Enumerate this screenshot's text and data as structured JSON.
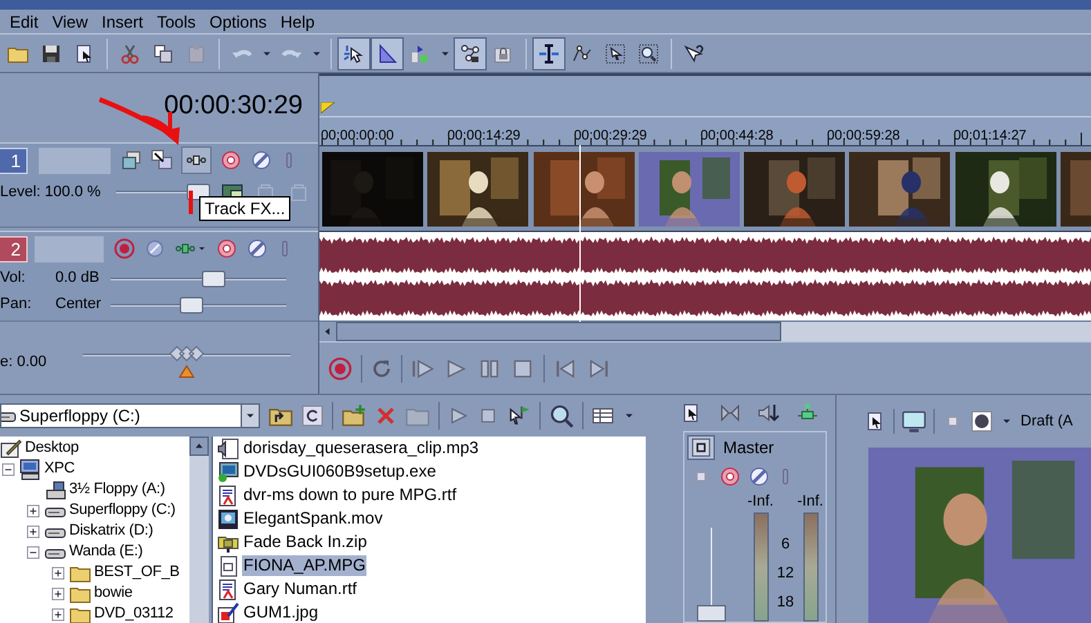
{
  "menu": [
    "Edit",
    "View",
    "Insert",
    "Tools",
    "Options",
    "Help"
  ],
  "toolbar": [
    {
      "kind": "open",
      "pressed": false
    },
    {
      "kind": "save",
      "pressed": false
    },
    {
      "kind": "properties",
      "pressed": false
    },
    {
      "kind": "separator"
    },
    {
      "kind": "cut",
      "pressed": false
    },
    {
      "kind": "copy",
      "pressed": false
    },
    {
      "kind": "paste",
      "pressed": false
    },
    {
      "kind": "separator"
    },
    {
      "kind": "undo",
      "pressed": false
    },
    {
      "kind": "dropdown",
      "pressed": false
    },
    {
      "kind": "redo",
      "pressed": false
    },
    {
      "kind": "dropdown",
      "pressed": false
    },
    {
      "kind": "separator"
    },
    {
      "kind": "snap",
      "pressed": true
    },
    {
      "kind": "crossfade",
      "pressed": true
    },
    {
      "kind": "ripple",
      "pressed": false
    },
    {
      "kind": "dropdown",
      "pressed": false
    },
    {
      "kind": "lock-envelopes",
      "pressed": true
    },
    {
      "kind": "ignore-grouping",
      "pressed": false
    },
    {
      "kind": "separator"
    },
    {
      "kind": "edit-tool",
      "pressed": true
    },
    {
      "kind": "envelope-tool",
      "pressed": false
    },
    {
      "kind": "selection-tool",
      "pressed": false
    },
    {
      "kind": "zoom-tool",
      "pressed": false
    },
    {
      "kind": "separator"
    },
    {
      "kind": "help",
      "pressed": false
    }
  ],
  "time": "00:00:30:29",
  "tracks": [
    {
      "kind": "video",
      "number": "1",
      "controls": [
        {
          "label": "Level: 100.0 %",
          "level": 1
        }
      ]
    },
    {
      "kind": "audio",
      "number": "2",
      "controls": [
        {
          "label": "Vol:",
          "reading": "0.0 dB",
          "level": 0.6
        },
        {
          "label": "Pan:",
          "reading": "Center",
          "level": 0.45
        }
      ]
    }
  ],
  "tooltip": "Track FX...",
  "rate": {
    "label": "e: 0.00",
    "level": 0.5
  },
  "ruler": [
    "00:00:00:00",
    "00:00:14:29",
    "00:00:29:29",
    "00:00:44:28",
    "00:00:59:28",
    "00:01:14:27"
  ],
  "explorer": {
    "location": "Superfloppy (C:)",
    "tree": [
      {
        "label": "Desktop",
        "kind": "desktop",
        "children": [
          {
            "label": "XPC",
            "kind": "computer",
            "expanded": true,
            "children": [
              {
                "label": "3½ Floppy (A:)",
                "kind": "floppy"
              },
              {
                "label": "Superfloppy (C:)",
                "kind": "drive",
                "expanded": false
              },
              {
                "label": "Diskatrix (D:)",
                "kind": "drive",
                "expanded": false
              },
              {
                "label": "Wanda (E:)",
                "kind": "drive",
                "expanded": true,
                "children": [
                  {
                    "label": "BEST_OF_B",
                    "kind": "folder",
                    "expanded": false
                  },
                  {
                    "label": "bowie",
                    "kind": "folder",
                    "expanded": false
                  },
                  {
                    "label": "DVD_03112",
                    "kind": "folder",
                    "expanded": false
                  }
                ]
              }
            ]
          }
        ]
      }
    ],
    "files": [
      {
        "name": "dorisday_queserasera_clip.mp3",
        "kind": "audio",
        "selected": false
      },
      {
        "name": "DVDsGUI060B9setup.exe",
        "kind": "program",
        "selected": false
      },
      {
        "name": "dvr-ms down to pure MPG.rtf",
        "kind": "document",
        "selected": false
      },
      {
        "name": "ElegantSpank.mov",
        "kind": "movie",
        "selected": false
      },
      {
        "name": "Fade Back In.zip",
        "kind": "archive",
        "selected": false
      },
      {
        "name": "FIONA_AP.MPG",
        "kind": "blank",
        "selected": true
      },
      {
        "name": "Gary Numan.rtf",
        "kind": "document",
        "selected": false
      },
      {
        "name": "GUM1.jpg",
        "selected": false
      }
    ]
  },
  "mixer": {
    "title": "Master",
    "meters": [
      "-Inf.",
      "-Inf."
    ],
    "scale": [
      "6",
      "12",
      "18"
    ],
    "level": 0
  },
  "preview": {
    "quality": "Draft (A"
  }
}
